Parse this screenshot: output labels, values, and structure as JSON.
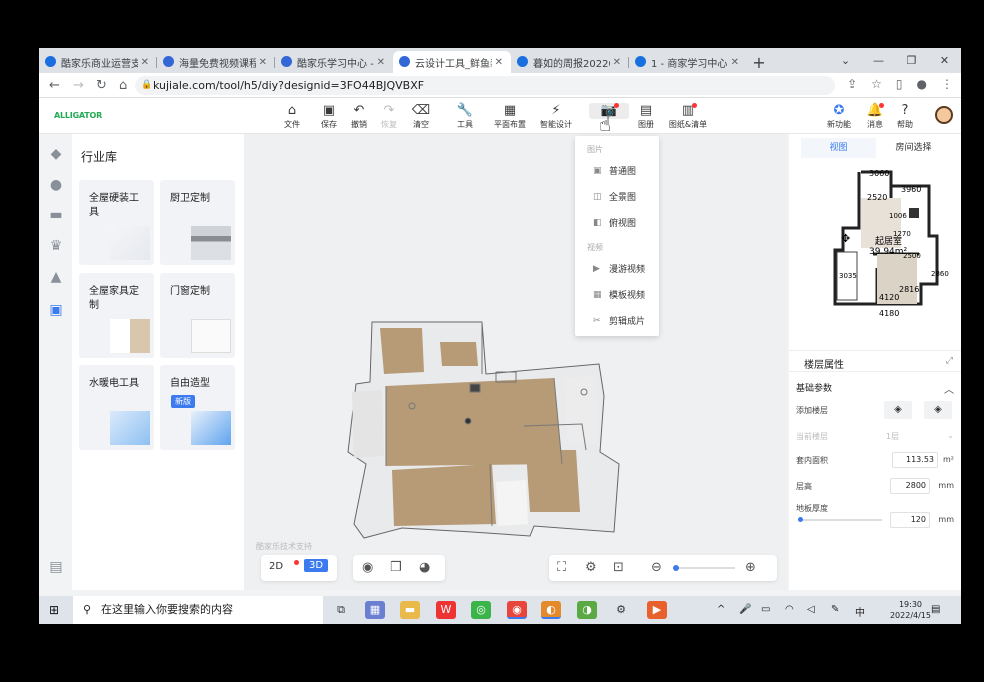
{
  "browser": {
    "tabs": [
      {
        "title": "酷家乐商业运营支持",
        "color": "#1a6fe0"
      },
      {
        "title": "海量免费视频课程",
        "color": "#3367d6"
      },
      {
        "title": "酷家乐学习中心 - 酷",
        "color": "#3367d6"
      },
      {
        "title": "云设计工具_鲜鱼装",
        "color": "#3367d6"
      },
      {
        "title": "暮如的周报202204",
        "color": "#1a6fe0"
      },
      {
        "title": "1 - 商家学习中心",
        "color": "#1a6fe0"
      }
    ],
    "url": "kujiale.com/tool/h5/diy?designid=3FO44BJQVBXF"
  },
  "app": {
    "logo": "ALLIGATOR",
    "toolbar": {
      "file": "文件",
      "save": "保存",
      "undo": "撤销",
      "redo": "恢复",
      "clear": "清空",
      "tools": "工具",
      "layout": "平面布置",
      "smart": "智能设计",
      "render": "渲染",
      "gallery": "图册",
      "drawings": "图纸&清单",
      "new_feature": "新功能",
      "message": "消息",
      "help": "帮助"
    },
    "library": {
      "title": "行业库",
      "cards": [
        {
          "label": "全屋硬装工具",
          "badge": ""
        },
        {
          "label": "厨卫定制",
          "badge": ""
        },
        {
          "label": "全屋家具定制",
          "badge": ""
        },
        {
          "label": "门窗定制",
          "badge": ""
        },
        {
          "label": "水暖电工具",
          "badge": ""
        },
        {
          "label": "自由造型",
          "badge": "新版"
        }
      ]
    },
    "render_menu": {
      "section_image": "图片",
      "images": [
        "普通图",
        "全景图",
        "俯视图"
      ],
      "section_video": "视频",
      "videos": [
        "漫游视频",
        "模板视频",
        "剪辑成片"
      ]
    },
    "watermark": "酷家乐技术支持",
    "view": {
      "mode2d": "2D",
      "mode3d": "3D"
    },
    "right": {
      "tab_view": "视图",
      "tab_rooms": "房间选择",
      "minimap": {
        "dims": [
          "3060",
          "2520",
          "3960",
          "1006",
          "1270",
          "2500",
          "2816",
          "4120",
          "4180",
          "2860",
          "3035"
        ],
        "room_label": "起居室",
        "room_area": "39.94m²"
      },
      "props_title": "楼层属性",
      "basic_params": "基础参数",
      "add_floor": "添加楼层",
      "current_floor": "当前楼层",
      "current_floor_val": "1层",
      "inner_area": "套内面积",
      "inner_area_val": "113.53",
      "inner_area_unit": "m²",
      "floor_height": "层高",
      "floor_height_val": "2800",
      "floor_height_unit": "mm",
      "slab_thickness": "地板厚度",
      "slab_thickness_val": "120",
      "slab_unit": "mm"
    }
  },
  "taskbar": {
    "search_placeholder": "在这里输入你要搜索的内容",
    "ime": "中",
    "time": "19:30",
    "date": "2022/4/15"
  }
}
